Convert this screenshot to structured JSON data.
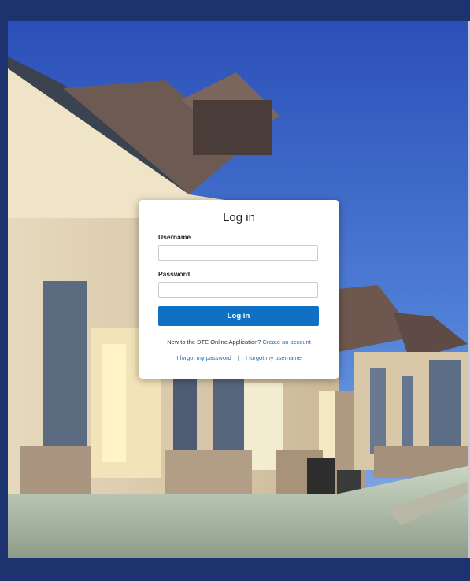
{
  "login": {
    "title": "Log in",
    "username_label": "Username",
    "username_value": "",
    "password_label": "Password",
    "password_value": "",
    "submit_label": "Log in",
    "new_prompt": "New to the DTE Online Application?",
    "create_account": "Create an account",
    "forgot_password": "I forgot my password",
    "separator": "|",
    "forgot_username": "I forgot my username"
  },
  "colors": {
    "frame": "#1c3370",
    "button": "#1071c4",
    "link": "#1b6fc0"
  }
}
